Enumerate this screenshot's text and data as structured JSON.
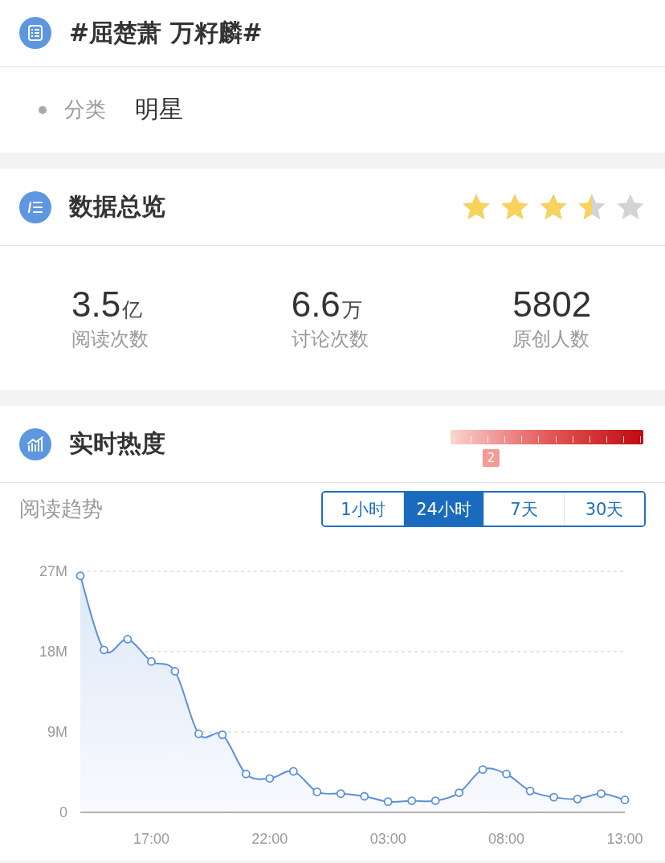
{
  "topic": {
    "title": "#屈楚萧 万籽麟#",
    "category_label": "分类",
    "category_value": "明星"
  },
  "overview": {
    "title": "数据总览",
    "stars": 3.5,
    "stats": [
      {
        "value": "3.5",
        "unit": "亿",
        "label": "阅读次数"
      },
      {
        "value": "6.6",
        "unit": "万",
        "label": "讨论次数"
      },
      {
        "value": "5802",
        "label": "原创人数"
      }
    ]
  },
  "realtime": {
    "title": "实时热度",
    "heat": {
      "label": "2"
    },
    "trend_label": "阅读趋势",
    "tabs": [
      {
        "label": "1小时",
        "selected": false
      },
      {
        "label": "24小时",
        "selected": true
      },
      {
        "label": "7天",
        "selected": false
      },
      {
        "label": "30天",
        "selected": false
      }
    ],
    "chart_data": {
      "type": "area",
      "categories": [
        null,
        null,
        null,
        "17:00",
        null,
        null,
        null,
        null,
        "22:00",
        null,
        null,
        null,
        null,
        "03:00",
        null,
        null,
        null,
        null,
        "08:00",
        null,
        null,
        null,
        null,
        "13:00"
      ],
      "series": [
        {
          "color": "#5b8fd9",
          "values": [
            26.5,
            18.2,
            19.4,
            16.9,
            15.8,
            8.8,
            8.7,
            4.3,
            3.8,
            4.6,
            2.3,
            2.1,
            1.8,
            1.2,
            1.3,
            1.3,
            2.2,
            4.8,
            4.3,
            2.4,
            1.7,
            1.5,
            2.1,
            1.4
          ]
        }
      ],
      "ylim": [
        0,
        27
      ],
      "yticks": [
        {
          "value": 0,
          "label": "0"
        },
        {
          "value": 9,
          "label": "9M"
        },
        {
          "value": 18,
          "label": "18M"
        },
        {
          "value": 27,
          "label": "27M"
        }
      ]
    }
  }
}
